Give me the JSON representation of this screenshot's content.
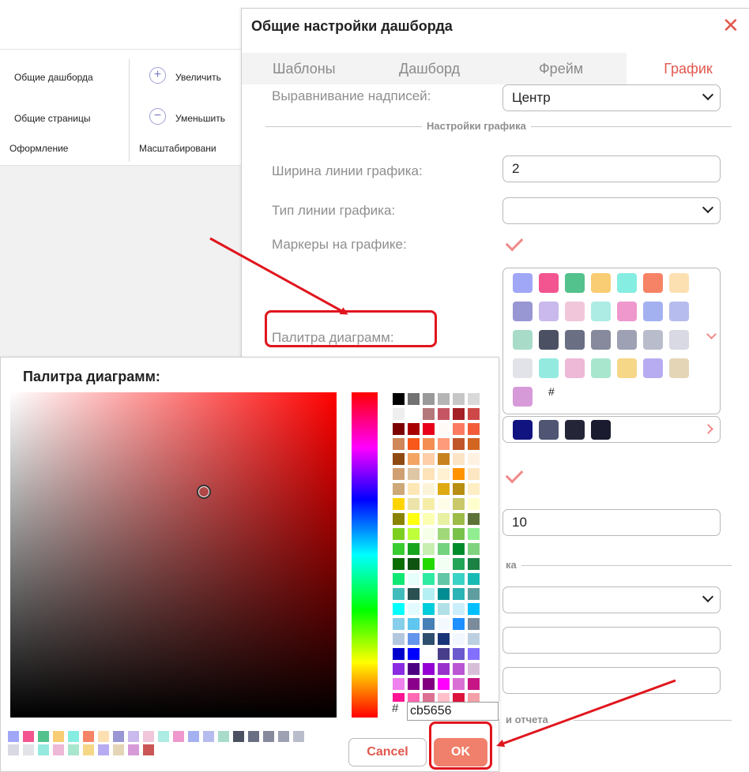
{
  "ribbon": {
    "dashboard_general": "Общие дашборда",
    "pages_general": "Общие страницы",
    "design": "Оформление",
    "zoom_in": "Увеличить",
    "zoom_out": "Уменьшить",
    "scaling": "Масштабировани"
  },
  "dialog": {
    "title": "Общие настройки дашборда",
    "close_icon": "close-icon",
    "tabs": [
      {
        "label": "Шаблоны"
      },
      {
        "label": "Дашборд"
      },
      {
        "label": "Фрейм"
      },
      {
        "label": "График",
        "active": true
      }
    ],
    "label_align": {
      "label": "Выравнивание надписей:",
      "value": "Центр"
    },
    "section_chart": "Настройки графика",
    "line_width": {
      "label": "Ширина линии графика:",
      "value": "2"
    },
    "line_type": {
      "label": "Тип линии графика:",
      "value": ""
    },
    "markers": {
      "label": "Маркеры на графике:",
      "checked": true
    },
    "palette": {
      "label": "Палитра диаграмм:",
      "swatches": [
        "#a1a7f7",
        "#f2558f",
        "#53c28c",
        "#f9cd73",
        "#86ede2",
        "#f68365",
        "#fde0b2",
        "#9896d3",
        "#c9b9ec",
        "#f1c6db",
        "#acece4",
        "#ee98cd",
        "#a4b1f1",
        "#b7bcee",
        "#a8dcc9",
        "#4b5162",
        "#6a6f84",
        "#868a9c",
        "#9da1b3",
        "#b9bccb",
        "#d8d9e3",
        "#e2e3e8",
        "#95eae0",
        "#eeb8d7",
        "#a8e6ce",
        "#f6d787",
        "#b7acf1",
        "#e4d5b6",
        "#d79ad9"
      ],
      "hash_symbol": "#"
    },
    "palette2": {
      "swatches": [
        "#111381",
        "#4f5573",
        "#242638",
        "#1a1b2e"
      ]
    },
    "value_10": "10",
    "section_partial": "ка",
    "section_report_partial": "и отчета"
  },
  "picker": {
    "title": "Палитра диаграмм:",
    "hash": "#",
    "hex_value": "cb5656",
    "grid": [
      [
        "#000000",
        "#727272",
        "#9a9a9a",
        "#b5b5b5",
        "#c7c7c7",
        "#d9d9d9"
      ],
      [
        "#eeeeee",
        "#ffffff",
        "#b37879",
        "#c55562",
        "#a42027",
        "#cf4848"
      ],
      [
        "#7c0000",
        "#a80000",
        "#e8001a",
        "#fffaf5",
        "#fa7b61",
        "#f35c38"
      ],
      [
        "#cf8658",
        "#f8581a",
        "#f48d52",
        "#fd9b7a",
        "#c0552a",
        "#d26522"
      ],
      [
        "#8f4a14",
        "#f3a463",
        "#fdcea8",
        "#c7821f",
        "#fbe3c5",
        "#fff2e2"
      ],
      [
        "#d09f71",
        "#dec6a4",
        "#fde2b8",
        "#fff1d2",
        "#ff9300",
        "#fde6c2"
      ],
      [
        "#cda978",
        "#fee7b6",
        "#fbf4d8",
        "#deaa12",
        "#b78e12",
        "#ffeec4"
      ],
      [
        "#ffd400",
        "#ece3aa",
        "#f5eca6",
        "#fffce8",
        "#c9c86a",
        "#ffffce"
      ],
      [
        "#8a8300",
        "#ffff10",
        "#fbffb3",
        "#e8f0a4",
        "#9dbb47",
        "#5d7239"
      ],
      [
        "#7ccf1f",
        "#bfff39",
        "#f6ffe8",
        "#a1d87a",
        "#78c24c",
        "#90ee90"
      ],
      [
        "#39cd32",
        "#19a420",
        "#c8eeb2",
        "#73d27e",
        "#028b2b",
        "#7fd27e"
      ],
      [
        "#0b6c00",
        "#0e5310",
        "#23d900",
        "#f2fff3",
        "#22a557",
        "#1b8144"
      ],
      [
        "#11e874",
        "#e6fffb",
        "#2eeba1",
        "#63c6a6",
        "#3bd2c7",
        "#19bab4"
      ],
      [
        "#41bcbd",
        "#2a5052",
        "#b3eef2",
        "#018d91",
        "#2bb3b6",
        "#5f9ea0"
      ],
      [
        "#00ffff",
        "#e2fbff",
        "#00cddb",
        "#b0e0e6",
        "#cbeefb",
        "#00bfff"
      ],
      [
        "#87ceeb",
        "#5ec6ef",
        "#4780b6",
        "#f3f9ff",
        "#1e90ff",
        "#7a8b9b"
      ],
      [
        "#b3c8df",
        "#6495ed",
        "#2f4f6f",
        "#183677",
        "#f3f7ff",
        "#bcd0e2"
      ],
      [
        "#0000cd",
        "#0000ff",
        "#ffffff",
        "#483d8b",
        "#6a5acd",
        "#8470ff"
      ],
      [
        "#8a2be2",
        "#4b0082",
        "#9400d3",
        "#9932cc",
        "#ba55d3",
        "#d8bfd8"
      ],
      [
        "#ee82ee",
        "#8b008b",
        "#800080",
        "#ff00ff",
        "#da70d6",
        "#c71585"
      ],
      [
        "#ff1493",
        "#ff69b4",
        "#db7093",
        "#ffc0cb",
        "#dc143c",
        "#f4a0a8"
      ]
    ],
    "recent": [
      "#a1a7f7",
      "#f2558f",
      "#53c28c",
      "#f9cd73",
      "#86ede2",
      "#f68365",
      "#fde0b2",
      "#9896d3",
      "#c9b9ec",
      "#f1c6db",
      "#acece4",
      "#ee98cd",
      "#a4b1f1",
      "#b7bcee",
      "#a8dcc9",
      "#4b5162",
      "#6a6f84",
      "#868a9c",
      "#9da1b3",
      "#b9bccb",
      "#d8d9e3",
      "#e2e3e8",
      "#95eae0",
      "#eeb8d7",
      "#a8e6ce",
      "#f6d787",
      "#b7acf1",
      "#e4d5b6",
      "#d79ad9",
      "#cb5656"
    ],
    "cancel_label": "Cancel",
    "ok_label": "OK"
  },
  "colors": {
    "accent": "#e0584e",
    "ok_button": "#f0806b",
    "annotation": "#e0151d"
  }
}
